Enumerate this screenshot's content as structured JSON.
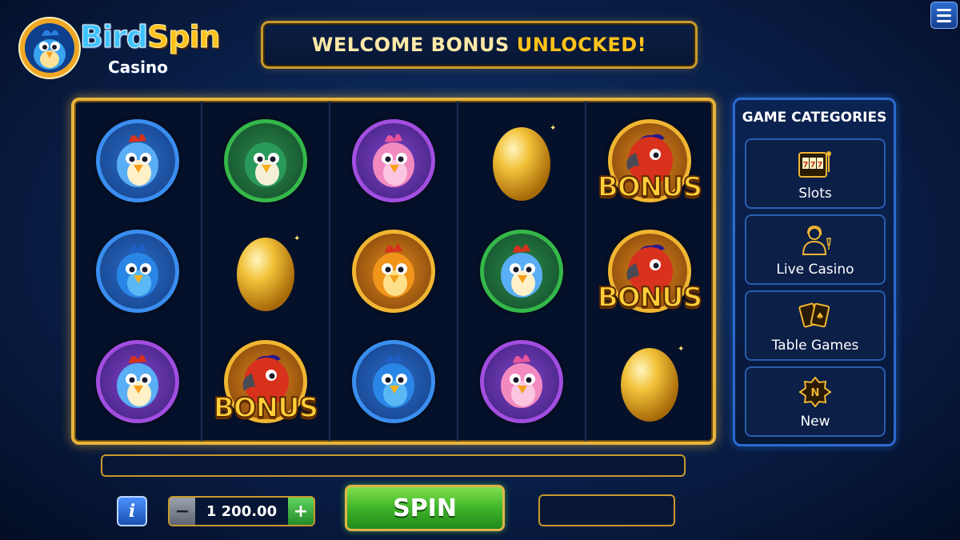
{
  "logo": {
    "word1": "Bird",
    "word2": "Spin",
    "subtitle": "Casino"
  },
  "banner": {
    "part1": "WELCOME BONUS",
    "part2": "UNLOCKED!"
  },
  "reels": [
    [
      "blue-bird-rooster",
      "blue-parrot",
      "purple-rooster"
    ],
    [
      "green-parrot",
      "golden-egg",
      "bonus-parrot"
    ],
    [
      "pink-bird",
      "golden-chick",
      "blue-parrot"
    ],
    [
      "golden-egg",
      "green-rooster",
      "pink-bird"
    ],
    [
      "bonus-parrot",
      "bonus-parrot",
      "golden-egg"
    ]
  ],
  "bonus_label": "BONUS",
  "side_panel": {
    "title": "GAME CATEGORIES",
    "categories": [
      {
        "label": "Slots",
        "icon": "slot-machine-icon"
      },
      {
        "label": "Live Casino",
        "icon": "dealer-icon"
      },
      {
        "label": "Table Games",
        "icon": "playing-cards-icon"
      },
      {
        "label": "New",
        "icon": "new-badge-icon",
        "badge": "N"
      }
    ]
  },
  "controls": {
    "info_label": "i",
    "bet_minus": "−",
    "bet_value": "1 200.00",
    "bet_plus": "+",
    "spin_label": "SPIN"
  },
  "colors": {
    "gold": "#e6b43c",
    "spin_green": "#3fb52a",
    "panel_blue": "#2b6ad0"
  }
}
